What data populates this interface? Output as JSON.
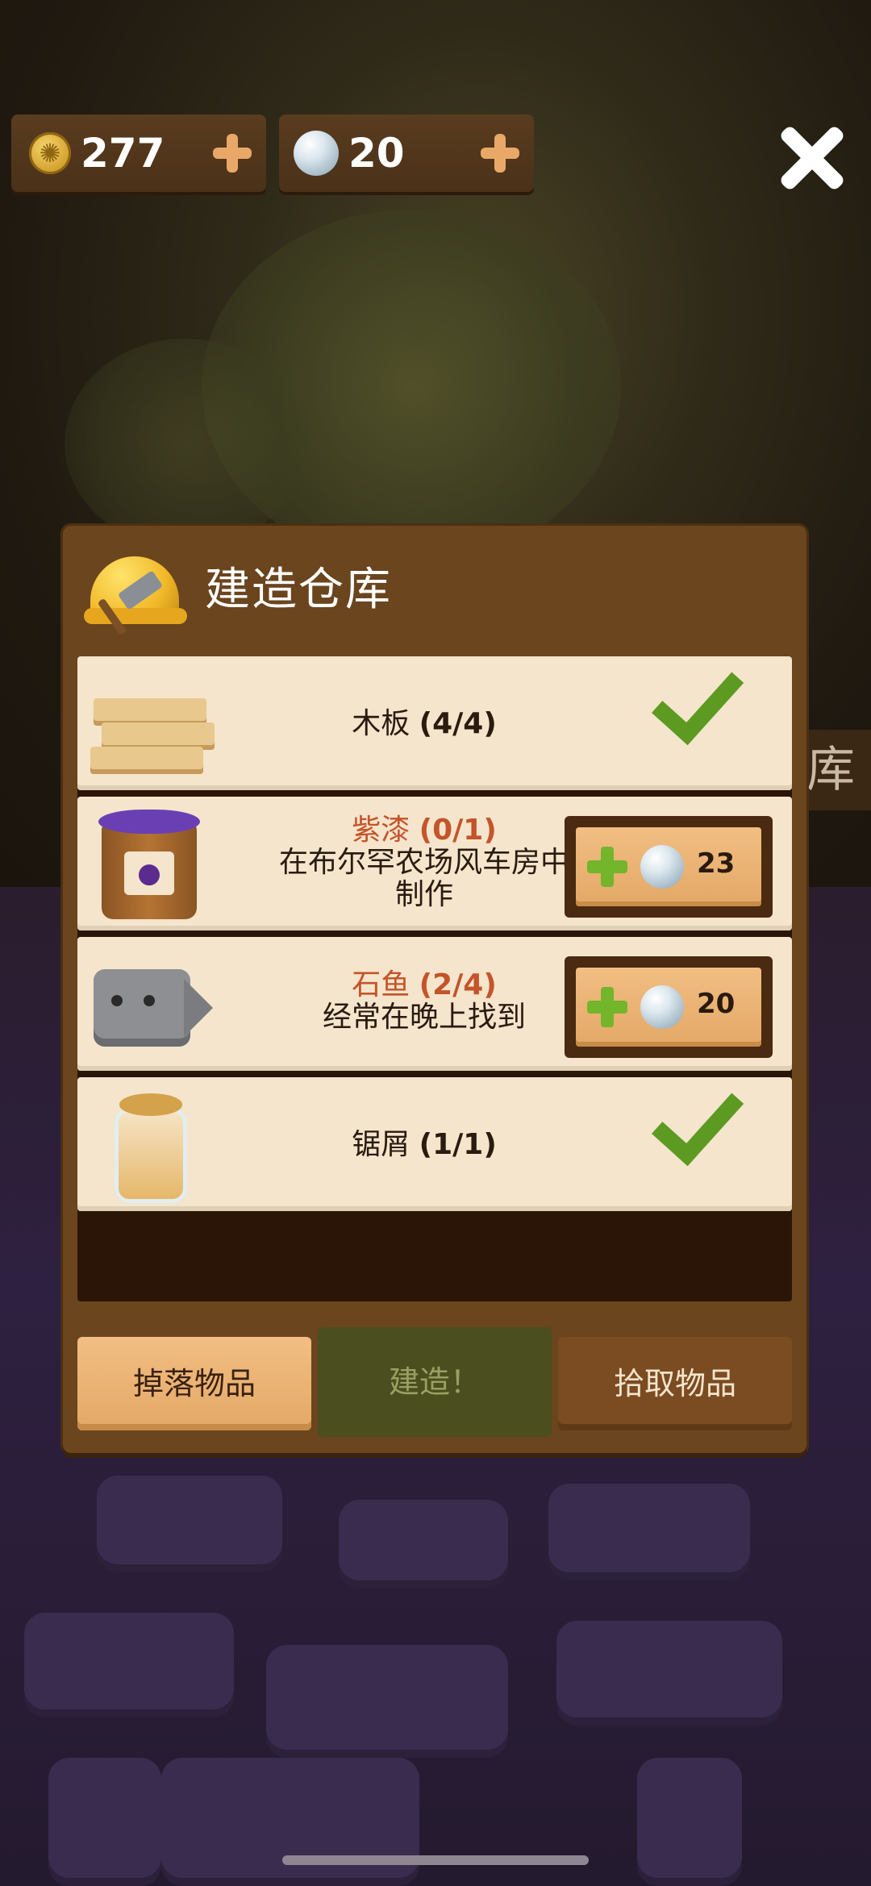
{
  "currency": {
    "coins": "277",
    "pearls": "20"
  },
  "side_label": "库",
  "dialog": {
    "title": "建造仓库",
    "items": [
      {
        "name": "木板",
        "progress": "(4/4)",
        "status": "complete"
      },
      {
        "name": "紫漆",
        "progress": "(0/1)",
        "hint": "在布尔罕农场风车房中制作",
        "status": "missing",
        "cost": "23"
      },
      {
        "name": "石鱼",
        "progress": "(2/4)",
        "hint": "经常在晚上找到",
        "status": "missing",
        "cost": "20"
      },
      {
        "name": "锯屑",
        "progress": "(1/1)",
        "status": "complete"
      }
    ]
  },
  "actions": {
    "drop": "掉落物品",
    "build": "建造！",
    "pick": "拾取物品"
  },
  "colors": {
    "panel": "#6a451e",
    "row": "#f4e5cc",
    "missing_name": "#c4542a",
    "check": "#5c9a22",
    "build_disabled": "#4b4e1e"
  }
}
